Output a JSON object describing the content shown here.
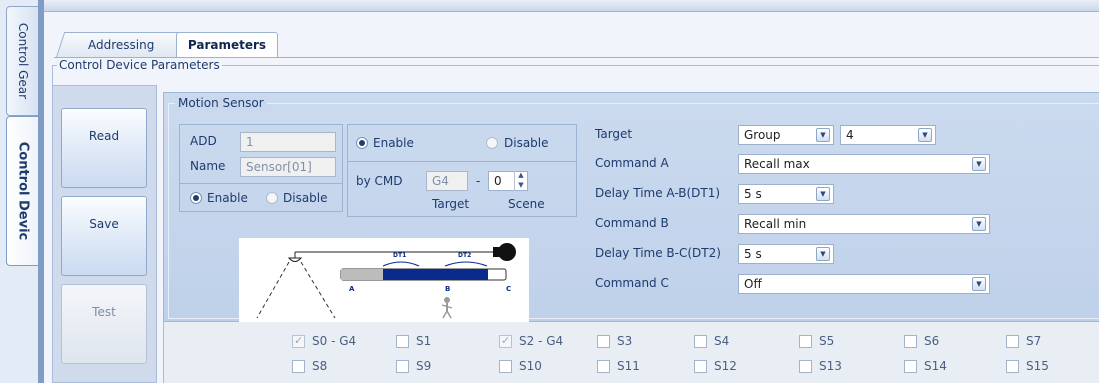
{
  "side_tabs": {
    "control_gear": "Control Gear",
    "control_device": "Control Devic"
  },
  "tabs": {
    "addressing": "Addressing",
    "parameters": "Parameters"
  },
  "group_title": "Control Device Parameters",
  "buttons": {
    "read": "Read",
    "save": "Save",
    "test": "Test"
  },
  "motion_sensor": {
    "title": "Motion Sensor",
    "add_label": "ADD",
    "add_value": "1",
    "name_label": "Name",
    "name_value": "Sensor[01]",
    "enable": "Enable",
    "disable": "Disable",
    "state_enabled": true,
    "cmd_enable": "Enable",
    "cmd_disable": "Disable",
    "by_cmd_label": "by CMD",
    "by_cmd_target": "G4",
    "dash": "-",
    "by_cmd_scene": "0",
    "target_caption": "Target",
    "scene_caption": "Scene"
  },
  "diagram": {
    "dt1": "DT1",
    "dt2": "DT2",
    "a": "A",
    "b": "B",
    "c": "C"
  },
  "settings": {
    "target_label": "Target",
    "target_type": "Group",
    "target_value": "4",
    "command_a_label": "Command A",
    "command_a": "Recall max",
    "delay_ab_label": "Delay Time A-B(DT1)",
    "delay_ab": "5 s",
    "command_b_label": "Command B",
    "command_b": "Recall min",
    "delay_bc_label": "Delay Time B-C(DT2)",
    "delay_bc": "5 s",
    "command_c_label": "Command C",
    "command_c": "Off"
  },
  "scenes": [
    {
      "label": "S0 - G4",
      "checked": true
    },
    {
      "label": "S1",
      "checked": false
    },
    {
      "label": "S2 - G4",
      "checked": true
    },
    {
      "label": "S3",
      "checked": false
    },
    {
      "label": "S4",
      "checked": false
    },
    {
      "label": "S5",
      "checked": false
    },
    {
      "label": "S6",
      "checked": false
    },
    {
      "label": "S7",
      "checked": false
    },
    {
      "label": "S8",
      "checked": false
    },
    {
      "label": "S9",
      "checked": false
    },
    {
      "label": "S10",
      "checked": false
    },
    {
      "label": "S11",
      "checked": false
    },
    {
      "label": "S12",
      "checked": false
    },
    {
      "label": "S13",
      "checked": false
    },
    {
      "label": "S14",
      "checked": false
    },
    {
      "label": "S15",
      "checked": false
    }
  ],
  "colors": {
    "accent": "#1a3e77",
    "panel": "#c7d7ed",
    "bar": "#0a2a8c"
  },
  "icons": {
    "dropdown": "chevron-down-icon",
    "spinner": "spin-arrows-icon",
    "person": "person-icon",
    "lamp": "lamp-icon",
    "sensor": "motion-sensor-icon"
  }
}
